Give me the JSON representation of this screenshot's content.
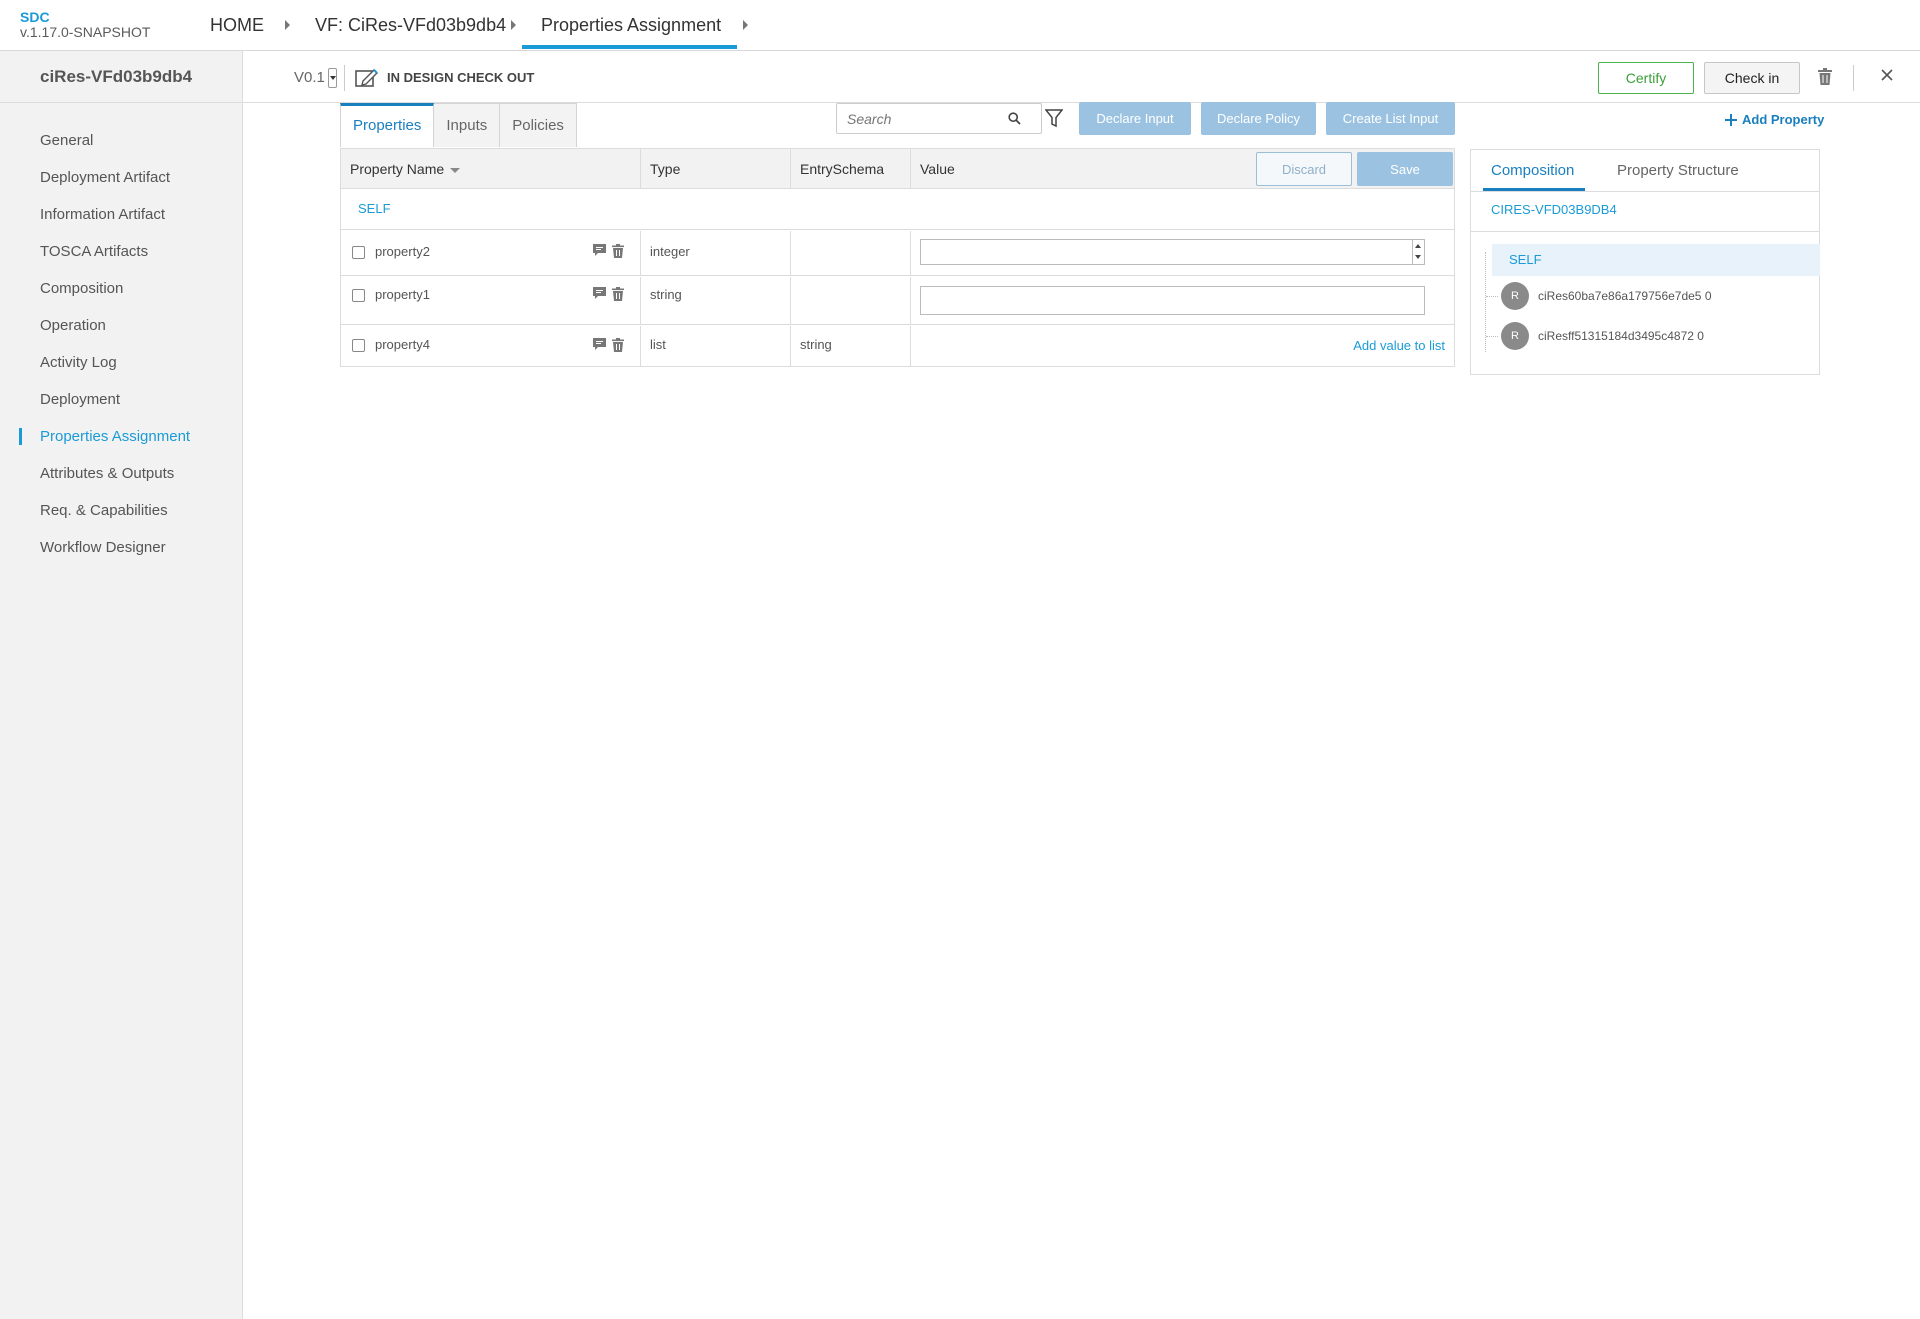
{
  "header": {
    "app_name": "SDC",
    "version": "v.1.17.0-SNAPSHOT",
    "breadcrumbs": [
      {
        "label": "HOME"
      },
      {
        "label": "VF: CiRes-VFd03b9db4"
      },
      {
        "label": "Properties Assignment"
      }
    ]
  },
  "sidebar": {
    "title": "ciRes-VFd03b9db4",
    "items": [
      {
        "label": "General"
      },
      {
        "label": "Deployment Artifact"
      },
      {
        "label": "Information Artifact"
      },
      {
        "label": "TOSCA Artifacts"
      },
      {
        "label": "Composition"
      },
      {
        "label": "Operation"
      },
      {
        "label": "Activity Log"
      },
      {
        "label": "Deployment"
      },
      {
        "label": "Properties Assignment"
      },
      {
        "label": "Attributes & Outputs"
      },
      {
        "label": "Req. & Capabilities"
      },
      {
        "label": "Workflow Designer"
      }
    ],
    "active_item": "Properties Assignment"
  },
  "subheader": {
    "version": "V0.1",
    "status": "IN DESIGN CHECK OUT",
    "certify_label": "Certify",
    "checkin_label": "Check in"
  },
  "tabs": [
    {
      "label": "Properties"
    },
    {
      "label": "Inputs"
    },
    {
      "label": "Policies"
    }
  ],
  "search": {
    "placeholder": "Search"
  },
  "actions": {
    "declare_input": "Declare Input",
    "declare_policy": "Declare Policy",
    "create_list_input": "Create List Input",
    "add_property": "Add Property"
  },
  "table": {
    "columns": [
      "Property Name",
      "Type",
      "EntrySchema",
      "Value"
    ],
    "discard_label": "Discard",
    "save_label": "Save",
    "group_label": "SELF",
    "rows": [
      {
        "name": "property2",
        "type": "integer",
        "entry_schema": "",
        "value": ""
      },
      {
        "name": "property1",
        "type": "string",
        "entry_schema": "",
        "value": ""
      },
      {
        "name": "property4",
        "type": "list",
        "entry_schema": "string",
        "action": "Add value to list"
      }
    ]
  },
  "right_panel": {
    "tabs": [
      {
        "label": "Composition"
      },
      {
        "label": "Property Structure"
      }
    ],
    "component_name": "CIRES-VFD03B9DB4",
    "tree": {
      "self_label": "SELF",
      "children": [
        {
          "avatar": "R",
          "label": "ciRes60ba7e86a179756e7de5 0"
        },
        {
          "avatar": "R",
          "label": "ciResff51315184d3495c4872 0"
        }
      ]
    }
  },
  "colors": {
    "accent": "#1a9bd7",
    "certify": "#4bb34b",
    "disabled_button": "#9bc3e1"
  }
}
